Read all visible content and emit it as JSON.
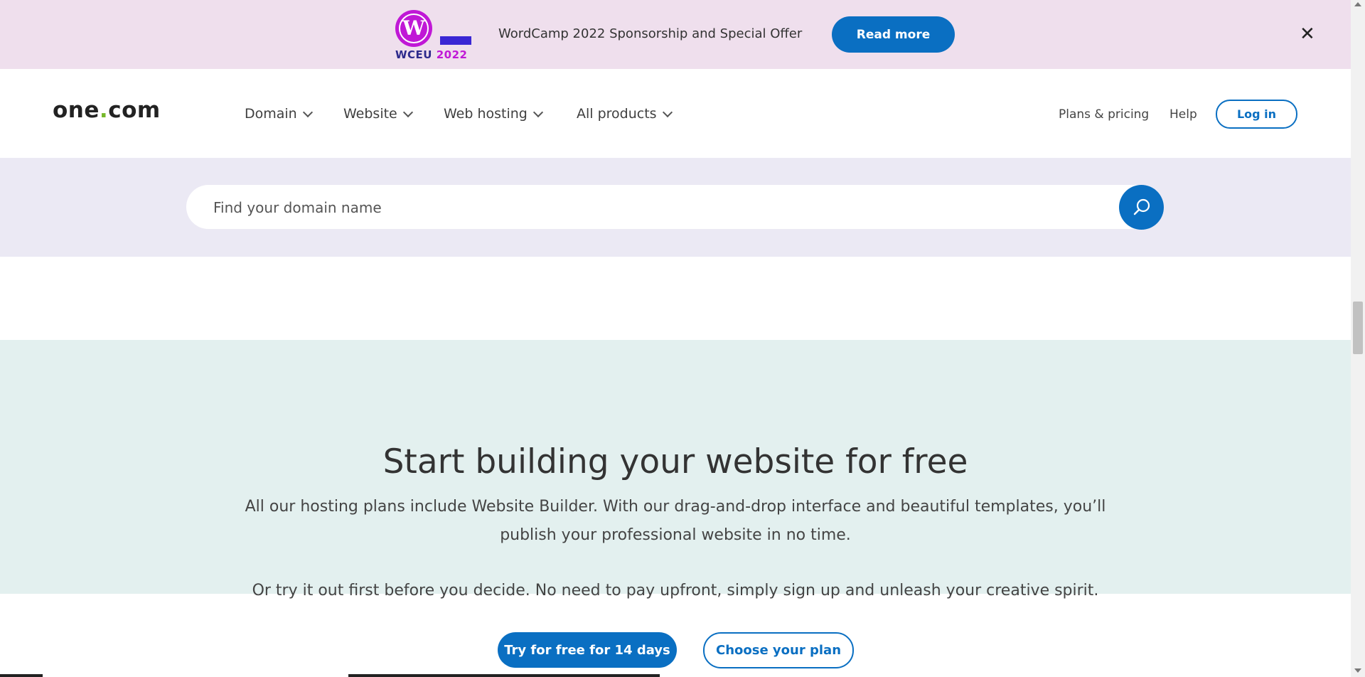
{
  "promo": {
    "logo_prefix": "WCEU",
    "logo_year": "2022",
    "text": "WordCamp 2022 Sponsorship and Special Offer",
    "button": "Read more",
    "close": "✕"
  },
  "header": {
    "logo_left": "one",
    "logo_dot": ".",
    "logo_right": "com",
    "nav": [
      "Domain",
      "Website",
      "Web hosting",
      "All products"
    ],
    "plans": "Plans & pricing",
    "help": "Help",
    "login": "Log in"
  },
  "search": {
    "placeholder": "Find your domain name"
  },
  "hero": {
    "title": "Start building your website for free",
    "line1": "All our hosting plans include Website Builder. With our drag-and-drop interface and beautiful templates, you’ll",
    "line2": "publish your professional website in no time.",
    "line3": "Or try it out first before you decide. No need to pay upfront, simply sign up and unleash your creative spirit.",
    "primary_button": "Try for free for 14 days",
    "secondary_button": "Choose your plan"
  },
  "colors": {
    "accent": "#0a6fc2",
    "promo_bg": "#efdfed",
    "search_band_bg": "#ebe9f4",
    "hero_bg": "#e3f0ef",
    "logo_dot": "#76b82a",
    "wp_purple": "#c018d6"
  }
}
